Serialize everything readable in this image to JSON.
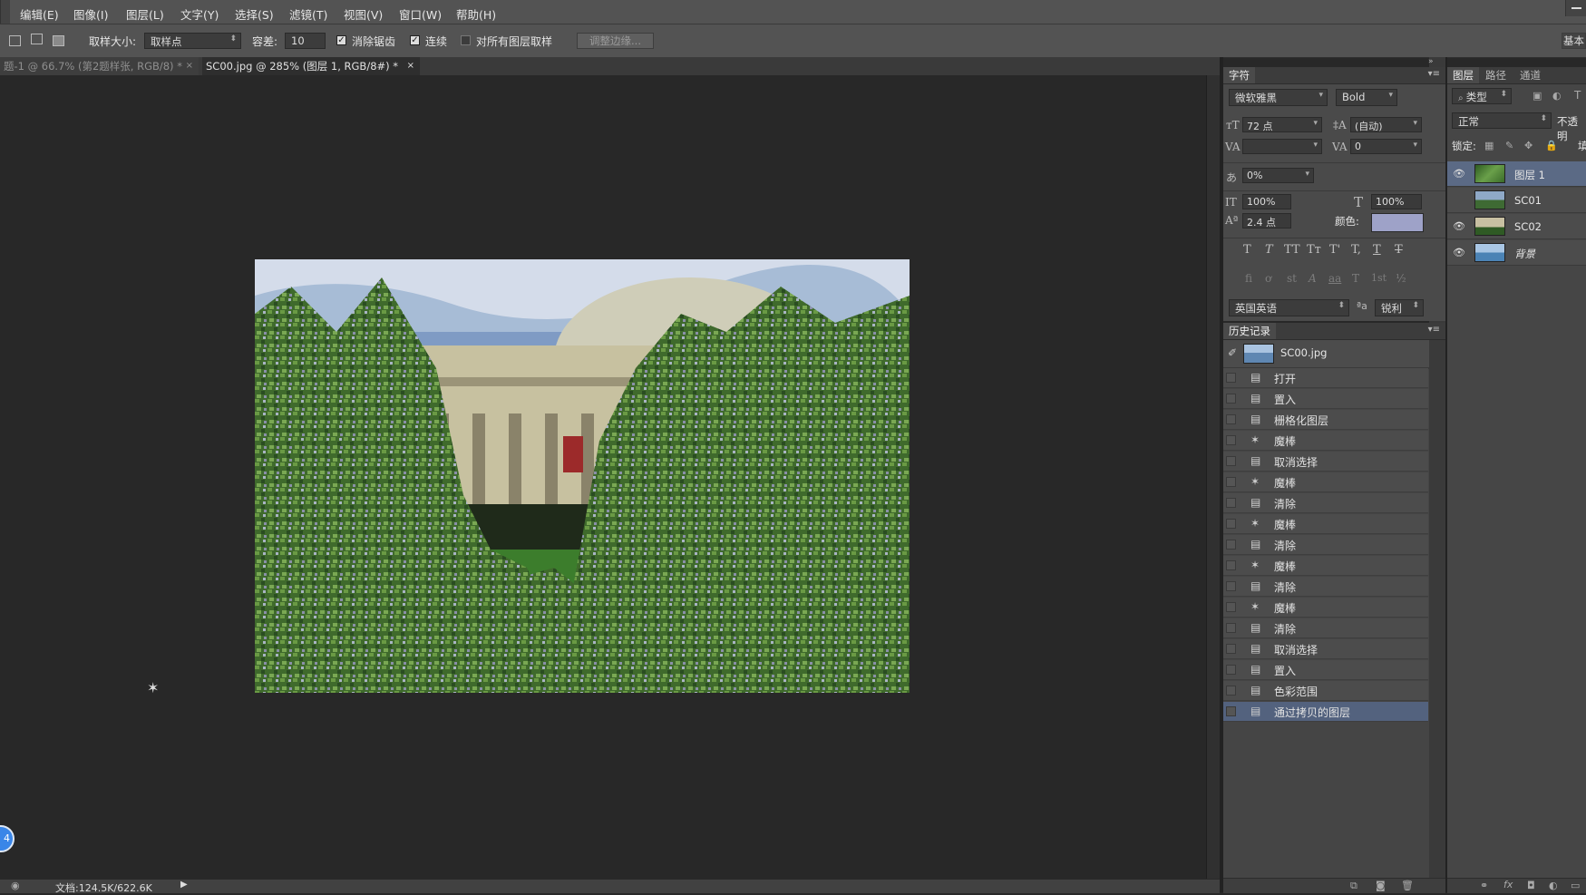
{
  "menu": {
    "items": [
      "编辑(E)",
      "图像(I)",
      "图层(L)",
      "文字(Y)",
      "选择(S)",
      "滤镜(T)",
      "视图(V)",
      "窗口(W)",
      "帮助(H)"
    ]
  },
  "options": {
    "sample_size_label": "取样大小:",
    "sample_size_value": "取样点",
    "tolerance_label": "容差:",
    "tolerance_value": "10",
    "antialias_label": "消除锯齿",
    "contiguous_label": "连续",
    "sample_all_label": "对所有图层取样",
    "refine_edge_label": "调整边缘...",
    "workspace_label": "基本"
  },
  "tabs": [
    {
      "label": "题-1 @ 66.7% (第2题样张, RGB/8) *",
      "close": "×"
    },
    {
      "label": "SC00.jpg @ 285% (图层 1, RGB/8#) *",
      "close": "×"
    }
  ],
  "status": {
    "doc_info": "文档:124.5K/622.6K"
  },
  "badge": {
    "text": "4"
  },
  "character_panel": {
    "tab": "字符",
    "font_family": "微软雅黑",
    "font_style": "Bold",
    "font_size": "72 点",
    "leading": "(自动)",
    "kerning": "",
    "tracking": "0",
    "tsume": "0%",
    "vertical_scale": "100%",
    "horizontal_scale": "100%",
    "baseline_shift": "2.4 点",
    "color_label": "颜色:",
    "color_swatch": "#9ea2c8",
    "type_buttons": [
      "T",
      "T",
      "TT",
      "Tт",
      "T'",
      "T,",
      "T",
      "T"
    ],
    "opentype_buttons": [
      "fi",
      "ơ",
      "st",
      "A",
      "aa",
      "T",
      "1st",
      "½"
    ],
    "language": "英国英语",
    "aa_icon": "ªa",
    "antialias": "锐利"
  },
  "history_panel": {
    "tab": "历史记录",
    "snapshot": "SC00.jpg",
    "items": [
      {
        "icon": "doc-icon",
        "label": "打开"
      },
      {
        "icon": "doc-icon",
        "label": "置入"
      },
      {
        "icon": "doc-icon",
        "label": "栅格化图层"
      },
      {
        "icon": "magic-wand-icon",
        "label": "魔棒"
      },
      {
        "icon": "doc-icon",
        "label": "取消选择"
      },
      {
        "icon": "magic-wand-icon",
        "label": "魔棒"
      },
      {
        "icon": "doc-icon",
        "label": "清除"
      },
      {
        "icon": "magic-wand-icon",
        "label": "魔棒"
      },
      {
        "icon": "doc-icon",
        "label": "清除"
      },
      {
        "icon": "magic-wand-icon",
        "label": "魔棒"
      },
      {
        "icon": "doc-icon",
        "label": "清除"
      },
      {
        "icon": "magic-wand-icon",
        "label": "魔棒"
      },
      {
        "icon": "doc-icon",
        "label": "清除"
      },
      {
        "icon": "doc-icon",
        "label": "取消选择"
      },
      {
        "icon": "doc-icon",
        "label": "置入"
      },
      {
        "icon": "doc-icon",
        "label": "色彩范围"
      },
      {
        "icon": "doc-icon",
        "label": "通过拷贝的图层"
      }
    ],
    "selected_index": 16
  },
  "layers_panel": {
    "tabs": [
      "图层",
      "路径",
      "通道"
    ],
    "filter_label": "类型",
    "blend_mode": "正常",
    "opacity_label": "不透明",
    "lock_label": "锁定:",
    "fill_label": "填",
    "layers": [
      {
        "name": "图层 1",
        "visible": true,
        "selected": true
      },
      {
        "name": "SC01",
        "visible": false,
        "selected": false
      },
      {
        "name": "SC02",
        "visible": true,
        "selected": false
      },
      {
        "name": "背景",
        "visible": true,
        "selected": false
      }
    ]
  },
  "colors": {
    "app_bg": "#282828",
    "panel_bg": "#4a4a4a",
    "selection": "#53627e",
    "badge": "#3a86e8"
  }
}
